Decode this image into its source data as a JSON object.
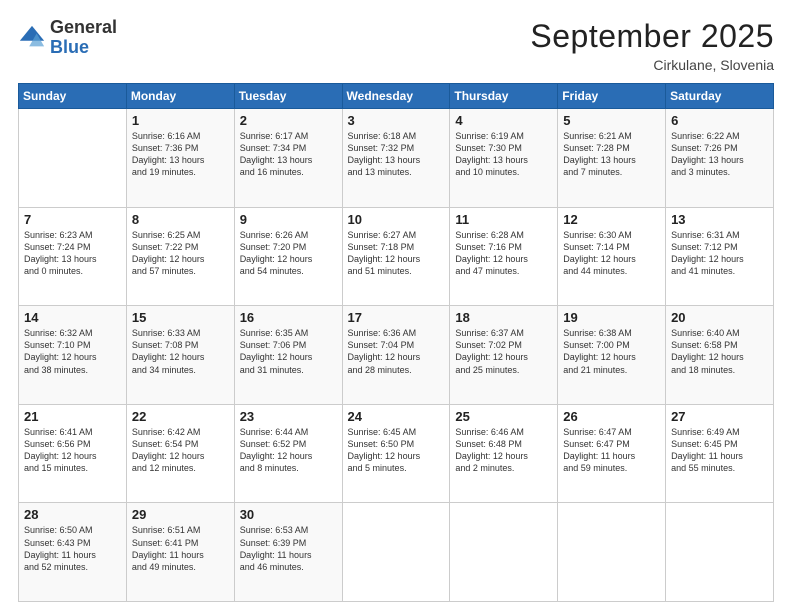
{
  "logo": {
    "general": "General",
    "blue": "Blue"
  },
  "header": {
    "month": "September 2025",
    "location": "Cirkulane, Slovenia"
  },
  "days_of_week": [
    "Sunday",
    "Monday",
    "Tuesday",
    "Wednesday",
    "Thursday",
    "Friday",
    "Saturday"
  ],
  "weeks": [
    [
      {
        "day": "",
        "info": ""
      },
      {
        "day": "1",
        "info": "Sunrise: 6:16 AM\nSunset: 7:36 PM\nDaylight: 13 hours\nand 19 minutes."
      },
      {
        "day": "2",
        "info": "Sunrise: 6:17 AM\nSunset: 7:34 PM\nDaylight: 13 hours\nand 16 minutes."
      },
      {
        "day": "3",
        "info": "Sunrise: 6:18 AM\nSunset: 7:32 PM\nDaylight: 13 hours\nand 13 minutes."
      },
      {
        "day": "4",
        "info": "Sunrise: 6:19 AM\nSunset: 7:30 PM\nDaylight: 13 hours\nand 10 minutes."
      },
      {
        "day": "5",
        "info": "Sunrise: 6:21 AM\nSunset: 7:28 PM\nDaylight: 13 hours\nand 7 minutes."
      },
      {
        "day": "6",
        "info": "Sunrise: 6:22 AM\nSunset: 7:26 PM\nDaylight: 13 hours\nand 3 minutes."
      }
    ],
    [
      {
        "day": "7",
        "info": "Sunrise: 6:23 AM\nSunset: 7:24 PM\nDaylight: 13 hours\nand 0 minutes."
      },
      {
        "day": "8",
        "info": "Sunrise: 6:25 AM\nSunset: 7:22 PM\nDaylight: 12 hours\nand 57 minutes."
      },
      {
        "day": "9",
        "info": "Sunrise: 6:26 AM\nSunset: 7:20 PM\nDaylight: 12 hours\nand 54 minutes."
      },
      {
        "day": "10",
        "info": "Sunrise: 6:27 AM\nSunset: 7:18 PM\nDaylight: 12 hours\nand 51 minutes."
      },
      {
        "day": "11",
        "info": "Sunrise: 6:28 AM\nSunset: 7:16 PM\nDaylight: 12 hours\nand 47 minutes."
      },
      {
        "day": "12",
        "info": "Sunrise: 6:30 AM\nSunset: 7:14 PM\nDaylight: 12 hours\nand 44 minutes."
      },
      {
        "day": "13",
        "info": "Sunrise: 6:31 AM\nSunset: 7:12 PM\nDaylight: 12 hours\nand 41 minutes."
      }
    ],
    [
      {
        "day": "14",
        "info": "Sunrise: 6:32 AM\nSunset: 7:10 PM\nDaylight: 12 hours\nand 38 minutes."
      },
      {
        "day": "15",
        "info": "Sunrise: 6:33 AM\nSunset: 7:08 PM\nDaylight: 12 hours\nand 34 minutes."
      },
      {
        "day": "16",
        "info": "Sunrise: 6:35 AM\nSunset: 7:06 PM\nDaylight: 12 hours\nand 31 minutes."
      },
      {
        "day": "17",
        "info": "Sunrise: 6:36 AM\nSunset: 7:04 PM\nDaylight: 12 hours\nand 28 minutes."
      },
      {
        "day": "18",
        "info": "Sunrise: 6:37 AM\nSunset: 7:02 PM\nDaylight: 12 hours\nand 25 minutes."
      },
      {
        "day": "19",
        "info": "Sunrise: 6:38 AM\nSunset: 7:00 PM\nDaylight: 12 hours\nand 21 minutes."
      },
      {
        "day": "20",
        "info": "Sunrise: 6:40 AM\nSunset: 6:58 PM\nDaylight: 12 hours\nand 18 minutes."
      }
    ],
    [
      {
        "day": "21",
        "info": "Sunrise: 6:41 AM\nSunset: 6:56 PM\nDaylight: 12 hours\nand 15 minutes."
      },
      {
        "day": "22",
        "info": "Sunrise: 6:42 AM\nSunset: 6:54 PM\nDaylight: 12 hours\nand 12 minutes."
      },
      {
        "day": "23",
        "info": "Sunrise: 6:44 AM\nSunset: 6:52 PM\nDaylight: 12 hours\nand 8 minutes."
      },
      {
        "day": "24",
        "info": "Sunrise: 6:45 AM\nSunset: 6:50 PM\nDaylight: 12 hours\nand 5 minutes."
      },
      {
        "day": "25",
        "info": "Sunrise: 6:46 AM\nSunset: 6:48 PM\nDaylight: 12 hours\nand 2 minutes."
      },
      {
        "day": "26",
        "info": "Sunrise: 6:47 AM\nSunset: 6:47 PM\nDaylight: 11 hours\nand 59 minutes."
      },
      {
        "day": "27",
        "info": "Sunrise: 6:49 AM\nSunset: 6:45 PM\nDaylight: 11 hours\nand 55 minutes."
      }
    ],
    [
      {
        "day": "28",
        "info": "Sunrise: 6:50 AM\nSunset: 6:43 PM\nDaylight: 11 hours\nand 52 minutes."
      },
      {
        "day": "29",
        "info": "Sunrise: 6:51 AM\nSunset: 6:41 PM\nDaylight: 11 hours\nand 49 minutes."
      },
      {
        "day": "30",
        "info": "Sunrise: 6:53 AM\nSunset: 6:39 PM\nDaylight: 11 hours\nand 46 minutes."
      },
      {
        "day": "",
        "info": ""
      },
      {
        "day": "",
        "info": ""
      },
      {
        "day": "",
        "info": ""
      },
      {
        "day": "",
        "info": ""
      }
    ]
  ]
}
